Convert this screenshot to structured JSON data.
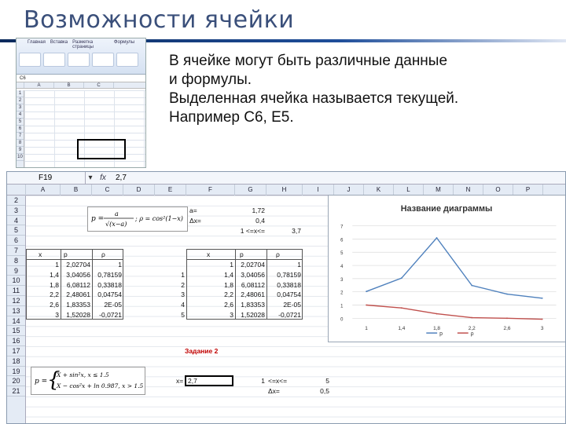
{
  "slide": {
    "title": "Возможности ячейки",
    "lines": [
      "В ячейке могут быть различные данные",
      "и формулы.",
      "Выделенная ячейка называется текущей.",
      "Например С6, Е5."
    ]
  },
  "mini_excel": {
    "tabs": [
      "Главная",
      "Вставка",
      "Разметка страницы",
      "Формулы"
    ],
    "name_box": "C6",
    "columns": [
      "A",
      "B",
      "C"
    ],
    "rows": [
      "1",
      "2",
      "3",
      "4",
      "5",
      "6",
      "7",
      "8",
      "9",
      "10"
    ]
  },
  "excel": {
    "name_box": "F19",
    "fx": "fx",
    "formula_value": "2,7",
    "columns": [
      "A",
      "B",
      "C",
      "D",
      "E",
      "F",
      "G",
      "H",
      "I",
      "J",
      "K",
      "L",
      "M",
      "N",
      "O",
      "P"
    ],
    "rows": [
      "2",
      "3",
      "4",
      "5",
      "6",
      "7",
      "8",
      "9",
      "10",
      "11",
      "12",
      "13",
      "14",
      "15",
      "16",
      "17",
      "18",
      "19",
      "20",
      "21"
    ],
    "params": {
      "a_label": "a=",
      "a_value": "1,72",
      "dx_label": "Δx=",
      "dx_value": "0,4",
      "cond": "1 <=x<=",
      "cond_value": "3,7"
    },
    "left_table": {
      "headers": [
        "x",
        "p",
        "ρ"
      ],
      "rows": [
        [
          "1",
          "2,02704",
          "1"
        ],
        [
          "1,4",
          "3,04056",
          "0,78159"
        ],
        [
          "1,8",
          "6,08112",
          "0,33818"
        ],
        [
          "2,2",
          "2,48061",
          "0,04754"
        ],
        [
          "2,6",
          "1,83353",
          "2E-05"
        ],
        [
          "3",
          "1,52028",
          "-0,0721"
        ]
      ]
    },
    "right_table": {
      "headers": [
        "x",
        "p",
        "ρ"
      ],
      "index": [
        "1",
        "2",
        "3",
        "4",
        "5"
      ],
      "rows": [
        [
          "1",
          "2,02704",
          "1"
        ],
        [
          "1,4",
          "3,04056",
          "0,78159"
        ],
        [
          "1,8",
          "6,08112",
          "0,33818"
        ],
        [
          "2,2",
          "2,48061",
          "0,04754"
        ],
        [
          "2,6",
          "1,83353",
          "2E-05"
        ],
        [
          "3",
          "1,52028",
          "-0,0721"
        ]
      ]
    },
    "task_label": "Задание 2",
    "x_label": "x=",
    "x_value": "2,7",
    "r19_num": "1",
    "r19_text": "<=x<=",
    "r19_value": "5",
    "r20_label": "Δx=",
    "r20_value": "0,5"
  },
  "chart_data": {
    "type": "line",
    "title": "Название диаграммы",
    "categories": [
      "1",
      "1,4",
      "1,8",
      "2,2",
      "2,6",
      "3"
    ],
    "ylim": [
      0,
      7
    ],
    "yticks": [
      "0",
      "1",
      "2",
      "3",
      "4",
      "5",
      "6",
      "7"
    ],
    "series": [
      {
        "name": "p",
        "color": "#4f81bd",
        "values": [
          2.03,
          3.04,
          6.08,
          2.48,
          1.83,
          1.52
        ]
      },
      {
        "name": "ρ",
        "color": "#c0504d",
        "values": [
          1.0,
          0.78,
          0.34,
          0.05,
          0.0,
          -0.07
        ]
      }
    ],
    "legend": "bottom"
  }
}
